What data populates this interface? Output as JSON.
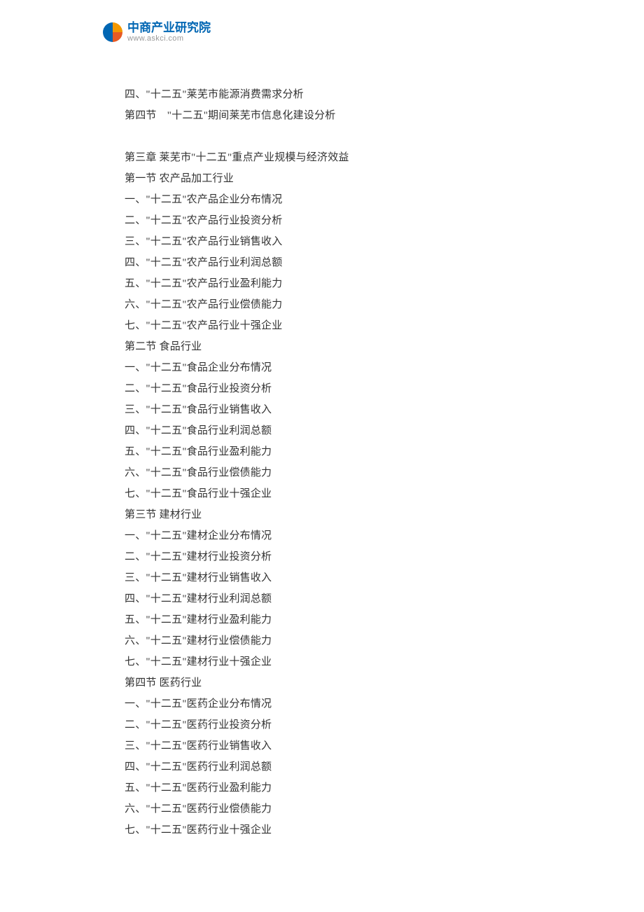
{
  "logo": {
    "cn_text": "中商产业研究院",
    "url_text": "www.askci.com"
  },
  "lines": [
    "四、\"十二五\"莱芜市能源消费需求分析",
    "第四节　\"十二五\"期间莱芜市信息化建设分析",
    "",
    "第三章  莱芜市\"十二五\"重点产业规模与经济效益",
    "第一节  农产品加工行业",
    "一、\"十二五\"农产品企业分布情况",
    "二、\"十二五\"农产品行业投资分析",
    "三、\"十二五\"农产品行业销售收入",
    "四、\"十二五\"农产品行业利润总额",
    "五、\"十二五\"农产品行业盈利能力",
    "六、\"十二五\"农产品行业偿债能力",
    "七、\"十二五\"农产品行业十强企业",
    "第二节  食品行业",
    "一、\"十二五\"食品企业分布情况",
    "二、\"十二五\"食品行业投资分析",
    "三、\"十二五\"食品行业销售收入",
    "四、\"十二五\"食品行业利润总额",
    "五、\"十二五\"食品行业盈利能力",
    "六、\"十二五\"食品行业偿债能力",
    "七、\"十二五\"食品行业十强企业",
    "第三节  建材行业",
    "一、\"十二五\"建材企业分布情况",
    "二、\"十二五\"建材行业投资分析",
    "三、\"十二五\"建材行业销售收入",
    "四、\"十二五\"建材行业利润总额",
    "五、\"十二五\"建材行业盈利能力",
    "六、\"十二五\"建材行业偿债能力",
    "七、\"十二五\"建材行业十强企业",
    "第四节  医药行业",
    "一、\"十二五\"医药企业分布情况",
    "二、\"十二五\"医药行业投资分析",
    "三、\"十二五\"医药行业销售收入",
    "四、\"十二五\"医药行业利润总额",
    "五、\"十二五\"医药行业盈利能力",
    "六、\"十二五\"医药行业偿债能力",
    "七、\"十二五\"医药行业十强企业"
  ]
}
